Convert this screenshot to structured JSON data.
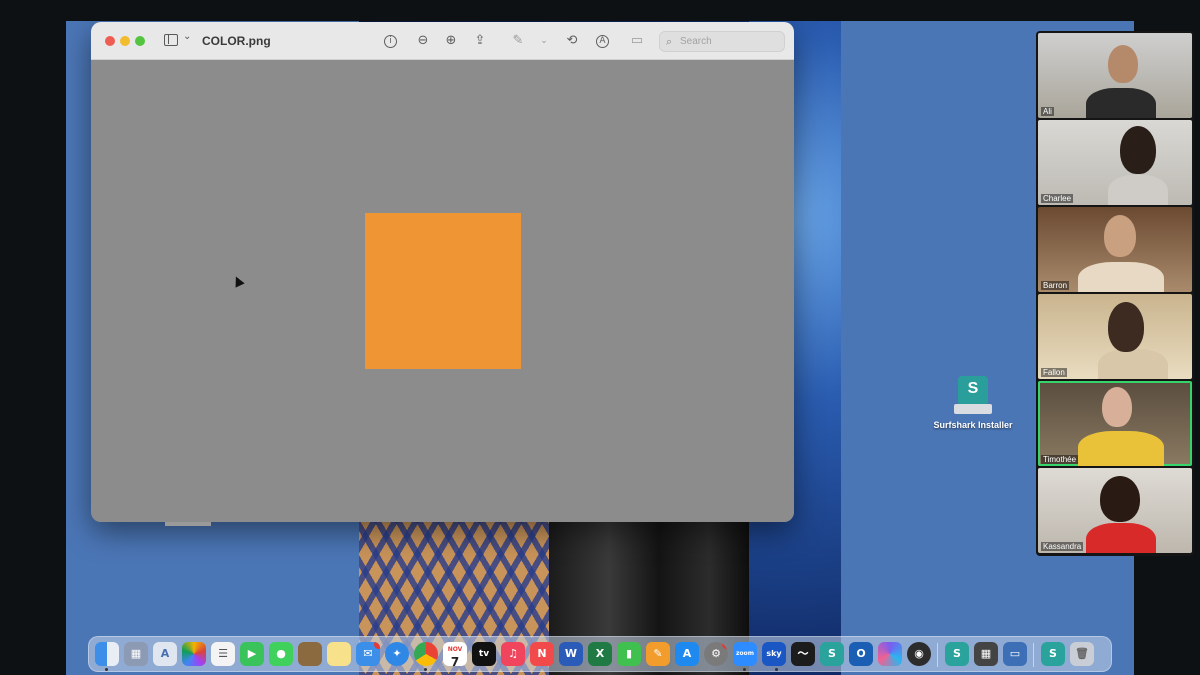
{
  "window": {
    "title": "COLOR.png",
    "search_placeholder": "Search"
  },
  "toolbar": {
    "icons": [
      "sidebar-icon",
      "info-icon",
      "zoom-out-icon",
      "zoom-in-icon",
      "share-icon",
      "markup-pen-icon",
      "rotate-icon",
      "annotate-icon",
      "signature-icon"
    ]
  },
  "image": {
    "square_color": "#ef9533",
    "canvas_color": "#8c8c8c"
  },
  "desktop": {
    "surfshark_label": "Surfshark Installer"
  },
  "participants": [
    {
      "name": "Ali"
    },
    {
      "name": "Charlee"
    },
    {
      "name": "Barron"
    },
    {
      "name": "Fallon"
    },
    {
      "name": "Timothée",
      "active_speaker": true
    },
    {
      "name": "Kassandra"
    }
  ],
  "dock": {
    "calendar_month": "NOV",
    "calendar_day": "7",
    "apps": [
      "finder",
      "launchpad",
      "preview",
      "photos",
      "reminders",
      "facetime",
      "messages",
      "maps",
      "notes",
      "mail",
      "safari",
      "chrome",
      "calendar",
      "tv",
      "music",
      "news",
      "word",
      "excel",
      "numbers",
      "pages",
      "app-store",
      "system-settings",
      "zoom",
      "sky-go",
      "stocks",
      "surfshark",
      "outlook",
      "copilot",
      "quicktime",
      "surfshark-vpn",
      "calculator",
      "desktop",
      "surfshark-installer",
      "trash"
    ],
    "zoom_label": "zoom",
    "sky_label": "sky"
  }
}
